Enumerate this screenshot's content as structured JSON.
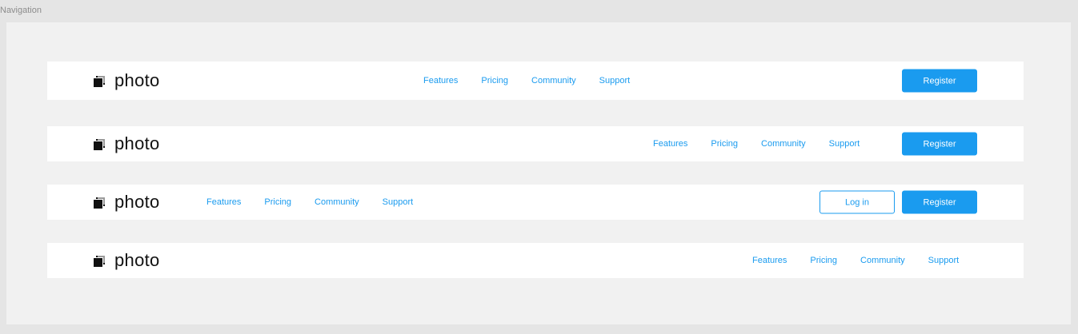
{
  "frame": {
    "label": "Navigation"
  },
  "brand": {
    "name": "photo"
  },
  "navbars": [
    {
      "links": [
        "Features",
        "Pricing",
        "Community",
        "Support"
      ],
      "register_label": "Register"
    },
    {
      "links": [
        "Features",
        "Pricing",
        "Community",
        "Support"
      ],
      "register_label": "Register"
    },
    {
      "links": [
        "Features",
        "Pricing",
        "Community",
        "Support"
      ],
      "login_label": "Log in",
      "register_label": "Register"
    },
    {
      "links": [
        "Features",
        "Pricing",
        "Community",
        "Support"
      ]
    }
  ],
  "colors": {
    "accent": "#1a9bef",
    "text": "#111111",
    "canvas": "#f1f1f1",
    "background": "#e5e5e5"
  }
}
